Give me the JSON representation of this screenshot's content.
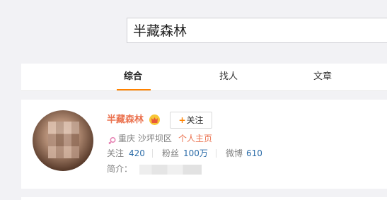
{
  "search": {
    "query": "半藏森林"
  },
  "tabs": [
    {
      "label": "综合",
      "active": true
    },
    {
      "label": "找人",
      "active": false
    },
    {
      "label": "文章",
      "active": false
    }
  ],
  "user": {
    "name": "半藏森林",
    "follow_label": "关注",
    "location": "重庆 沙坪坝区",
    "homepage_label": "个人主页",
    "stats": [
      {
        "label": "关注",
        "value": "420"
      },
      {
        "label": "粉丝",
        "value": "100万"
      },
      {
        "label": "微博",
        "value": "610"
      }
    ],
    "intro_label": "简介："
  },
  "colors": {
    "accent": "#ff8200",
    "name": "#eb7350",
    "link": "#2b6ca8"
  }
}
